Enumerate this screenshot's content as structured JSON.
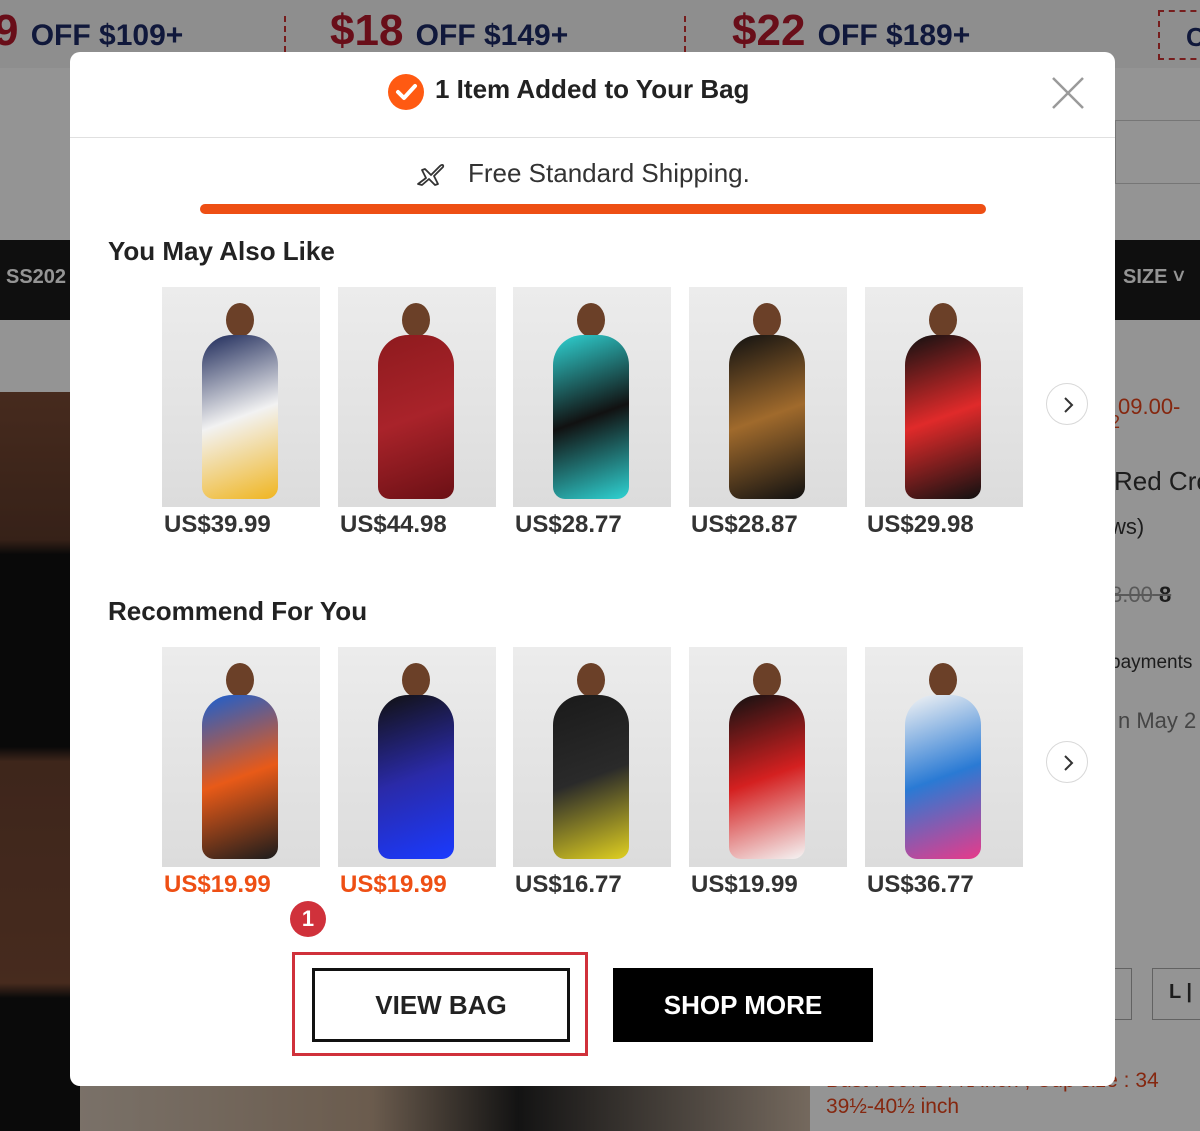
{
  "background_page": {
    "promo_items": [
      {
        "amount": "9",
        "rest": "OFF $109+"
      },
      {
        "amount": "$18",
        "rest": "OFF $149+"
      },
      {
        "amount": "$22",
        "rest": "OFF $189+"
      }
    ],
    "promo_boxed": "C",
    "nav_left": "SS202",
    "nav_right": "SIZE ˅",
    "side_price": "09.00-",
    "side_red": "2",
    "side_name": "Red Cro",
    "side_reviews": "ws)",
    "side_old_price": "8.00",
    "side_old_extra": "8",
    "side_payments": "payments",
    "side_date": "n May 2",
    "side_size": "L |",
    "desc_line1": "Bust : 30½-37½ inch , Cup size : 34",
    "desc_line2": "39½-40½ inch"
  },
  "modal": {
    "title": "1 Item Added to Your Bag",
    "shipping_text": "Free Standard Shipping.",
    "shipping_progress": 1.0,
    "section_also_like": "You May Also Like",
    "section_recommend": "Recommend For You",
    "also_like": [
      {
        "price": "US$39.99",
        "sale": false,
        "colors": [
          "#1e2a5a",
          "#f2f2f2",
          "#f0b520"
        ]
      },
      {
        "price": "US$44.98",
        "sale": false,
        "colors": [
          "#8e1a1e",
          "#a9232a",
          "#6b1015"
        ]
      },
      {
        "price": "US$28.77",
        "sale": false,
        "colors": [
          "#2fd3d3",
          "#111111",
          "#2fd3d3"
        ]
      },
      {
        "price": "US$28.87",
        "sale": false,
        "colors": [
          "#111111",
          "#a06a2c",
          "#111111"
        ]
      },
      {
        "price": "US$29.98",
        "sale": false,
        "colors": [
          "#111111",
          "#e02a2a",
          "#111111"
        ]
      }
    ],
    "recommend": [
      {
        "price": "US$19.99",
        "sale": true,
        "colors": [
          "#1a5fd0",
          "#e85a18",
          "#1c1c1c"
        ]
      },
      {
        "price": "US$19.99",
        "sale": true,
        "colors": [
          "#111111",
          "#2a2aa8",
          "#1a3aff"
        ]
      },
      {
        "price": "US$16.77",
        "sale": false,
        "colors": [
          "#1a1a1a",
          "#2a2a2a",
          "#e0d020"
        ]
      },
      {
        "price": "US$19.99",
        "sale": false,
        "colors": [
          "#111111",
          "#d42020",
          "#f5f5f5"
        ]
      },
      {
        "price": "US$36.77",
        "sale": false,
        "colors": [
          "#f4f4f4",
          "#2a7ad4",
          "#e83a8a"
        ]
      }
    ],
    "view_bag_label": "VIEW BAG",
    "shop_more_label": "SHOP MORE",
    "step_badge": "1"
  },
  "colors": {
    "accent": "#ee4f14",
    "highlight": "#d0313b"
  }
}
